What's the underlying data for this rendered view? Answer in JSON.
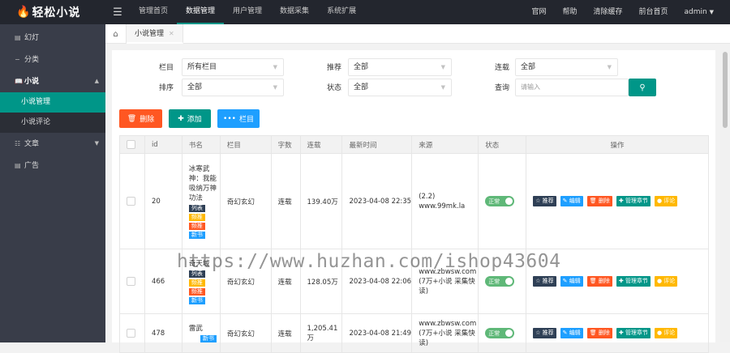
{
  "logo": {
    "text": "轻松小说",
    "icon": "flame-icon"
  },
  "topnav": [
    "管理首页",
    "数据管理",
    "用户管理",
    "数据采集",
    "系统扩展"
  ],
  "rightnav": [
    "官网",
    "帮助",
    "清除缓存",
    "前台首页",
    "admin"
  ],
  "sidebar": {
    "items": [
      {
        "label": "幻灯",
        "icon": "slides-icon"
      },
      {
        "label": "分类",
        "icon": "minus-icon"
      },
      {
        "label": "小说",
        "icon": "book-icon"
      },
      {
        "label": "文章",
        "icon": "article-icon"
      },
      {
        "label": "广告",
        "icon": "ad-icon"
      }
    ],
    "sub": [
      "小说管理",
      "小说评论"
    ]
  },
  "tabs": {
    "active": "小说管理"
  },
  "filters": {
    "column_label": "栏目",
    "column_value": "所有栏目",
    "recommend_label": "推荐",
    "recommend_value": "全部",
    "serial_label": "连载",
    "serial_value": "全部",
    "sort_label": "排序",
    "sort_value": "全部",
    "status_label": "状态",
    "status_value": "全部",
    "query_label": "查询",
    "query_placeholder": "请输入"
  },
  "toolbar": {
    "delete": "删除",
    "add": "添加",
    "column": "栏目"
  },
  "colors": {
    "teal": "#009688",
    "red": "#ff5722",
    "blue": "#1e9fff",
    "dark": "#2f4056",
    "orange": "#ffb800",
    "green": "#5fb878"
  },
  "table": {
    "headers": [
      "id",
      "书名",
      "栏目",
      "字数",
      "连载",
      "最新时间",
      "来源",
      "状态",
      "操作"
    ],
    "rows": [
      {
        "id": "20",
        "title": "冰寒武神：我能吸纳万神功法",
        "badges": [
          "列表",
          "频推",
          "频推",
          "新书"
        ],
        "column": "奇幻玄幻",
        "words": "连载",
        "serial": "139.40万",
        "time": "2023-04-08 22:35",
        "source": "(2.2)\nwww.99mk.la",
        "status": "正常"
      },
      {
        "id": "466",
        "title": "奇天域",
        "badges": [
          "列表",
          "频推",
          "频推",
          "新书"
        ],
        "column": "奇幻玄幻",
        "words": "连载",
        "serial": "128.05万",
        "time": "2023-04-08 22:06",
        "source": "www.zbwsw.com\n(7万+小说 采集快读)",
        "status": "正常"
      },
      {
        "id": "478",
        "title": "雷武",
        "badges": [
          "新书"
        ],
        "column": "奇幻玄幻",
        "words": "连载",
        "serial": "1,205.41\n万",
        "time": "2023-04-08 21:49",
        "source": "www.zbwsw.com\n(7万+小说 采集快读)",
        "status": "正常"
      }
    ],
    "ops": [
      "推荐",
      "编辑",
      "删除",
      "管理章节",
      "评论"
    ]
  },
  "watermark": "https://www.huzhan.com/ishop43604"
}
